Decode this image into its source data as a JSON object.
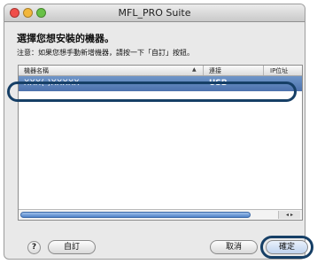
{
  "window": {
    "title": "MFL_PRO Suite"
  },
  "dialog": {
    "heading": "選擇您想安裝的機器。",
    "note": "注意：如果您想手動新增機器，請按一下「自訂」按鈕。"
  },
  "table": {
    "columns": [
      "機器名稱",
      "連接",
      "IP位址"
    ],
    "sort_arrow": "▲",
    "rows": [
      {
        "name": "XXX(-)XXXXX",
        "connection": "USB",
        "ip": ""
      }
    ],
    "scroll_arrows": "◂ ▸"
  },
  "buttons": {
    "help": "?",
    "custom": "自訂",
    "cancel": "取消",
    "ok": "確定"
  },
  "colors": {
    "selection": "#5a7fb8",
    "callout_outline": "#163f66"
  }
}
